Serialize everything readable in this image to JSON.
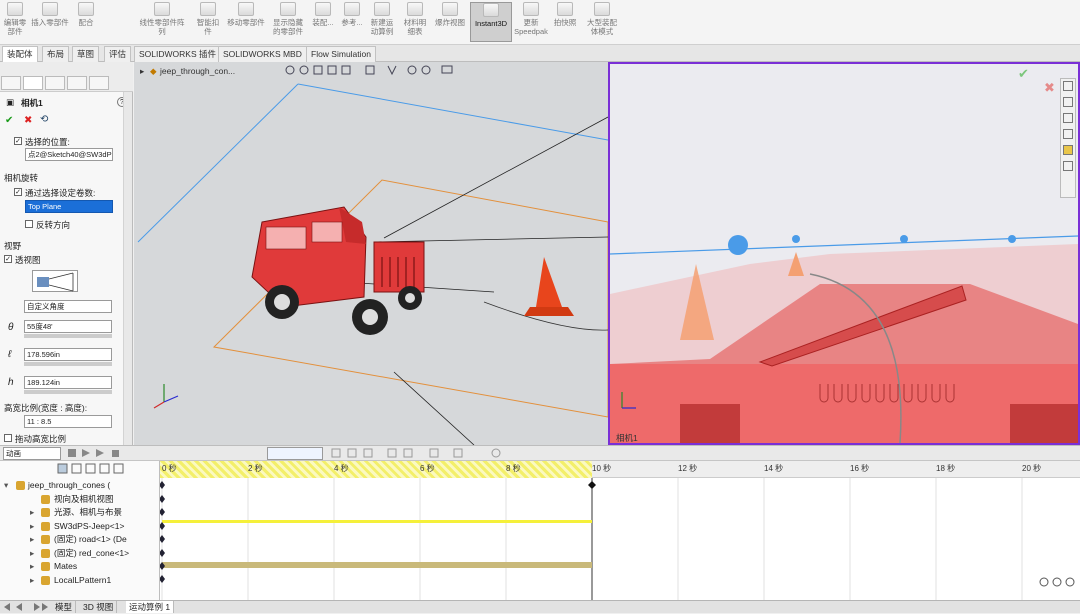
{
  "ribbon": {
    "items": [
      {
        "label": "编辑零\n部件"
      },
      {
        "label": "插入零部件"
      },
      {
        "label": "配合"
      },
      {
        "label": "线性零部件阵\n列"
      },
      {
        "label": "智能扣\n件"
      },
      {
        "label": "移动零部件"
      },
      {
        "label": "显示隐藏\n的零部件"
      },
      {
        "label": "装配..."
      },
      {
        "label": "参考..."
      },
      {
        "label": "新建运\n动算例"
      },
      {
        "label": "材料明\n细表"
      },
      {
        "label": "爆炸视图"
      },
      {
        "label": "Instant3D"
      },
      {
        "label": "更新\nSpeedpak"
      },
      {
        "label": "拍快照"
      },
      {
        "label": "大型装配\n体模式"
      }
    ]
  },
  "tabs": [
    "装配体",
    "布局",
    "草图",
    "评估",
    "SOLIDWORKS 插件",
    "SOLIDWORKS MBD",
    "Flow Simulation"
  ],
  "pm": {
    "title": "相机1",
    "help": "?",
    "ok": "✔",
    "cancel": "✖",
    "pin": "⟲",
    "position_label": "选择的位置:",
    "position_value": "点2@Sketch40@SW3dPS",
    "rotation_section": "相机旋转",
    "rotation_check_label": "通过选择设定卷数:",
    "rotation_value": "Top Plane",
    "flip_label": "反转方向",
    "fov_section": "视野",
    "perspective_label": "透视图",
    "view_mode": "自定义角度",
    "theta_symbol": "θ",
    "theta_value": "55度48'",
    "l_symbol": "ℓ",
    "l_value": "178.596in",
    "h_symbol": "h",
    "h_value": "189.124in",
    "aspect_label": "高宽比例(宽度 : 高度):",
    "aspect_value": "11 : 8.5",
    "drag_label": "拖动高宽比例"
  },
  "viewport": {
    "left_title": "jeep_through_con...",
    "right_title": "相机1"
  },
  "anim": {
    "mode": "动画",
    "rate": ""
  },
  "timeline": {
    "ticks": [
      "0 秒",
      "2 秒",
      "4 秒",
      "6 秒",
      "8 秒",
      "10 秒",
      "12 秒",
      "14 秒",
      "16 秒",
      "18 秒",
      "20 秒"
    ]
  },
  "tree": {
    "rows": [
      {
        "label": "jeep_through_cones  (",
        "expand": "▾",
        "icon": "assembly-icon"
      },
      {
        "label": "视向及相机视图",
        "expand": "",
        "icon": "camera-icon"
      },
      {
        "label": "光源、相机与布景",
        "expand": "▸",
        "icon": "light-icon"
      },
      {
        "label": "SW3dPS-Jeep<1>",
        "expand": "▸",
        "icon": "part-icon"
      },
      {
        "label": "(固定) road<1> (De",
        "expand": "▸",
        "icon": "part-icon"
      },
      {
        "label": "(固定) red_cone<1>",
        "expand": "▸",
        "icon": "part-icon"
      },
      {
        "label": "Mates",
        "expand": "▸",
        "icon": "mates-icon"
      },
      {
        "label": "LocalLPattern1",
        "expand": "▸",
        "icon": "pattern-icon"
      }
    ]
  },
  "status": {
    "tabs": [
      "模型",
      "3D 视图",
      "运动算例 1"
    ]
  },
  "colors": {
    "accent": "#1b6fd8",
    "jeep": "#e03a3a",
    "cone": "#e8451c",
    "keyframe_bar": "#f5f03a",
    "mates_bar": "#c9b97a",
    "viewport_border": "#7a2fd6"
  }
}
